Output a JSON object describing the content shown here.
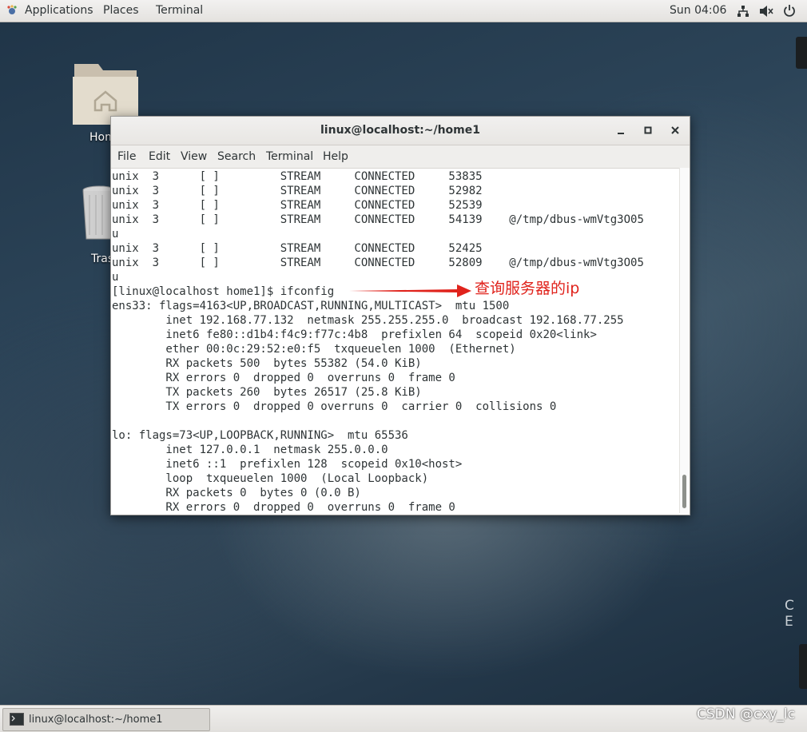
{
  "topbar": {
    "applications": "Applications",
    "places": "Places",
    "terminal": "Terminal",
    "clock": "Sun 04:06"
  },
  "desktop": {
    "home_label": "Hom",
    "trash_label": "Tras",
    "side_letters": "C E"
  },
  "window": {
    "title": "linux@localhost:~/home1",
    "menu": [
      "File",
      "Edit",
      "View",
      "Search",
      "Terminal",
      "Help"
    ],
    "terminal_lines": [
      "unix  3      [ ]         STREAM     CONNECTED     53835",
      "unix  3      [ ]         STREAM     CONNECTED     52982",
      "unix  3      [ ]         STREAM     CONNECTED     52539",
      "unix  3      [ ]         STREAM     CONNECTED     54139    @/tmp/dbus-wmVtg3O05",
      "u",
      "unix  3      [ ]         STREAM     CONNECTED     52425",
      "unix  3      [ ]         STREAM     CONNECTED     52809    @/tmp/dbus-wmVtg3O05",
      "u",
      "[linux@localhost home1]$ ifconfig",
      "ens33: flags=4163<UP,BROADCAST,RUNNING,MULTICAST>  mtu 1500",
      "        inet 192.168.77.132  netmask 255.255.255.0  broadcast 192.168.77.255",
      "        inet6 fe80::d1b4:f4c9:f77c:4b8  prefixlen 64  scopeid 0x20<link>",
      "        ether 00:0c:29:52:e0:f5  txqueuelen 1000  (Ethernet)",
      "        RX packets 500  bytes 55382 (54.0 KiB)",
      "        RX errors 0  dropped 0  overruns 0  frame 0",
      "        TX packets 260  bytes 26517 (25.8 KiB)",
      "        TX errors 0  dropped 0 overruns 0  carrier 0  collisions 0",
      "",
      "lo: flags=73<UP,LOOPBACK,RUNNING>  mtu 65536",
      "        inet 127.0.0.1  netmask 255.0.0.0",
      "        inet6 ::1  prefixlen 128  scopeid 0x10<host>",
      "        loop  txqueuelen 1000  (Local Loopback)",
      "        RX packets 0  bytes 0 (0.0 B)",
      "        RX errors 0  dropped 0  overruns 0  frame 0"
    ],
    "annotation": "查询服务器的ip"
  },
  "taskbar": {
    "task_label": "linux@localhost:~/home1"
  },
  "watermark": "CSDN @cxy_lc",
  "colors": {
    "annotation": "#e0231c",
    "terminal_text": "#2e3436"
  }
}
